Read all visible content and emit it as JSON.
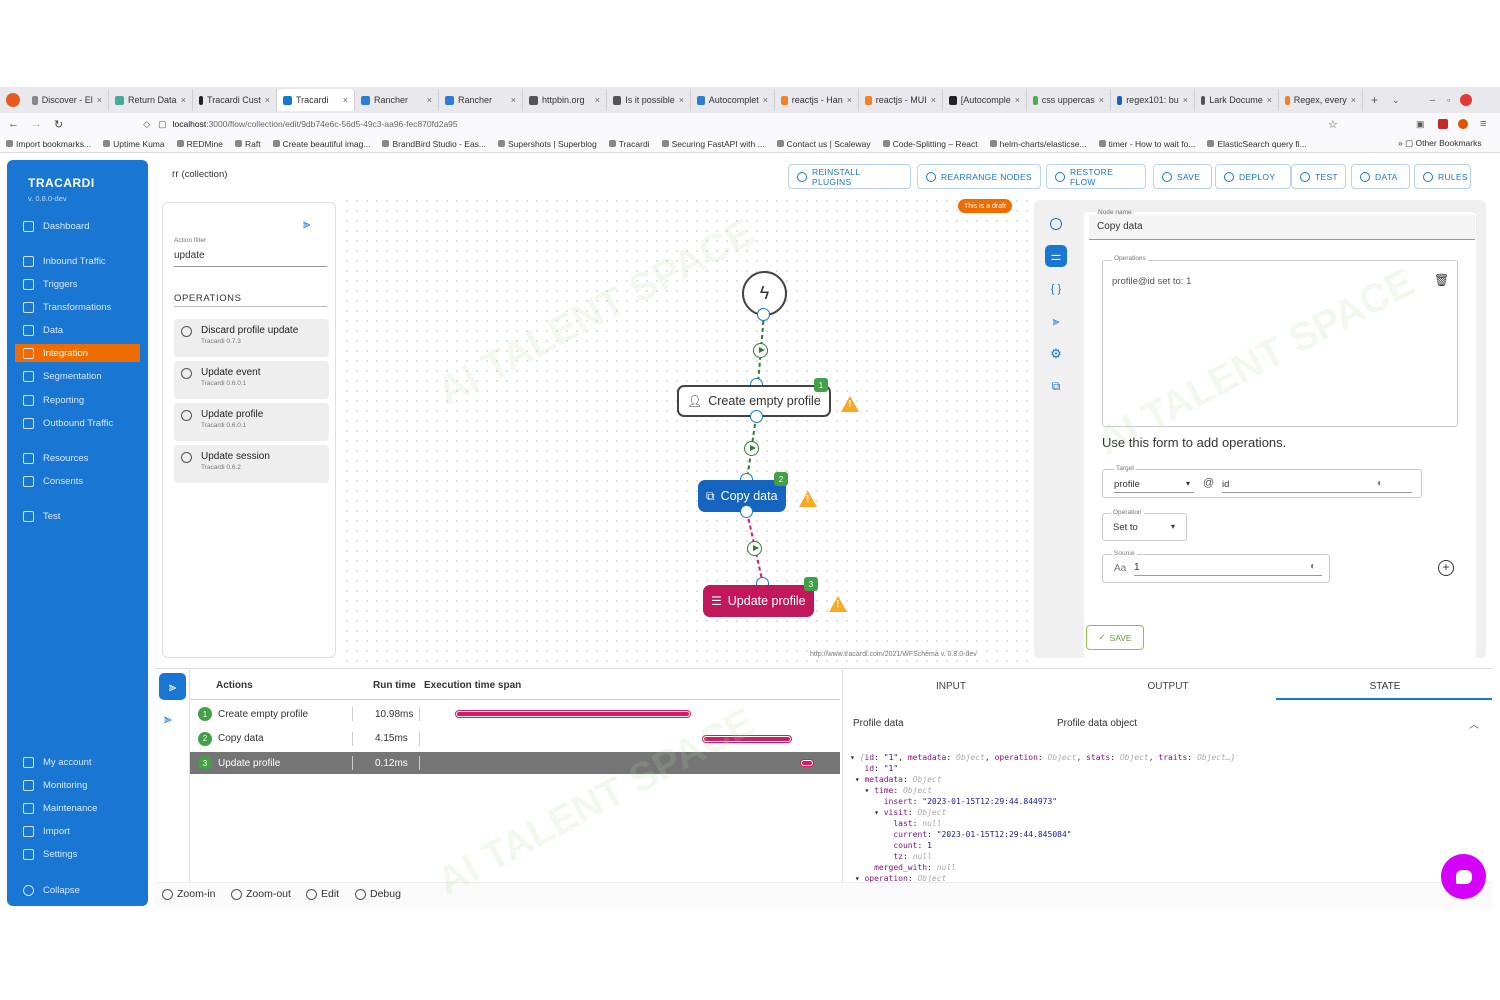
{
  "browser": {
    "tabs": [
      {
        "label": "Discover - El",
        "color": "#888"
      },
      {
        "label": "Return Data",
        "color": "#4a9"
      },
      {
        "label": "Tracardi Cust",
        "color": "#222"
      },
      {
        "label": "Tracardi",
        "color": "#1976d2",
        "active": true
      },
      {
        "label": "Rancher",
        "color": "#2a7fd4"
      },
      {
        "label": "Rancher",
        "color": "#2a7fd4"
      },
      {
        "label": "httpbin.org",
        "color": "#555"
      },
      {
        "label": "Is it possible",
        "color": "#555"
      },
      {
        "label": "Autocomplet",
        "color": "#2a7fd4"
      },
      {
        "label": "reactjs - Han",
        "color": "#f48024"
      },
      {
        "label": "reactjs - MUI",
        "color": "#f48024"
      },
      {
        "label": "[Autocomple",
        "color": "#222"
      },
      {
        "label": "css uppercas",
        "color": "#4caf50"
      },
      {
        "label": "regex101: bu",
        "color": "#1565c0"
      },
      {
        "label": "Lark Docume",
        "color": "#555"
      },
      {
        "label": "Regex, every",
        "color": "#f48024"
      }
    ],
    "url_host": "localhost",
    "url_path": ":3000/flow/collection/edit/9db74e6c-56d5-49c3-aa96-fec870fd2a95",
    "bookmarks": [
      "Import bookmarks...",
      "Uptime Kuma",
      "REDMine",
      "Raft",
      "Create beautiful imag...",
      "BrandBird Studio - Eas...",
      "Supershots | Superblog",
      "Tracardi",
      "Securing FastAPI with ...",
      "Contact us | Scaleway",
      "Code-Splitting – React",
      "helm-charts/elasticse...",
      "timer - How to wait fo...",
      "ElasticSearch query fi..."
    ],
    "other_bookmarks": "Other Bookmarks"
  },
  "sidebar": {
    "brand": "TRACARDI",
    "version": "v. 0.8.0-dev",
    "items": [
      "Dashboard",
      "Inbound Traffic",
      "Triggers",
      "Transformations",
      "Data",
      "Integration",
      "Segmentation",
      "Reporting",
      "Outbound Traffic",
      "Resources",
      "Consents",
      "Test"
    ],
    "bottom_items": [
      "My account",
      "Monitoring",
      "Maintenance",
      "Import",
      "Settings"
    ],
    "collapse": "Collapse"
  },
  "header": {
    "breadcrumb_prefix": "rr",
    "breadcrumb": "(collection)",
    "buttons": [
      "REINSTALL PLUGINS",
      "REARRANGE NODES",
      "RESTORE FLOW",
      "SAVE",
      "DEPLOY",
      "TEST",
      "DATA",
      "RULES"
    ]
  },
  "left_panel": {
    "action_filter_label": "Action filter",
    "action_filter_value": "update",
    "operations_title": "OPERATIONS",
    "operations": [
      {
        "title": "Discard profile update",
        "sub": "Tracardi 0.7.3"
      },
      {
        "title": "Update event",
        "sub": "Tracardi 0.6.0.1"
      },
      {
        "title": "Update profile",
        "sub": "Tracardi 0.6.0.1"
      },
      {
        "title": "Update session",
        "sub": "Tracardi 0.6.2"
      }
    ]
  },
  "canvas": {
    "draft_badge": "This is a draft",
    "schema_url": "http://www.tracardi.com/2021/WFSchema v. 0.8.0-dev",
    "nodes": [
      {
        "label": "Create empty profile",
        "badge": "1"
      },
      {
        "label": "Copy data",
        "badge": "2"
      },
      {
        "label": "Update profile",
        "badge": "3"
      }
    ]
  },
  "right_panel": {
    "node_name_label": "Node name",
    "node_name_value": "Copy data",
    "operations_label": "Operations",
    "operation_text": "profile@id set to: 1",
    "hint": "Use this form to add operations.",
    "target_label": "Target",
    "target_value": "profile",
    "target_path": "id",
    "operation_label": "Operation",
    "operation_value": "Set to",
    "source_label": "Source",
    "source_prefix": "Aa",
    "source_value": "1",
    "save": "SAVE"
  },
  "debug": {
    "col_actions": "Actions",
    "col_runtime": "Run time",
    "col_span": "Execution time span",
    "rows": [
      {
        "n": "1",
        "action": "Create empty profile",
        "time": "10.98ms"
      },
      {
        "n": "2",
        "action": "Copy data",
        "time": "4.15ms"
      },
      {
        "n": "3",
        "action": "Update profile",
        "time": "0.12ms"
      }
    ],
    "tabs": [
      "INPUT",
      "OUTPUT",
      "STATE"
    ],
    "profile_data": "Profile data",
    "profile_data_object": "Profile data object"
  },
  "bottom_toolbar": [
    "Zoom-in",
    "Zoom-out",
    "Edit",
    "Debug"
  ],
  "watermark": "AI TALENT SPACE"
}
